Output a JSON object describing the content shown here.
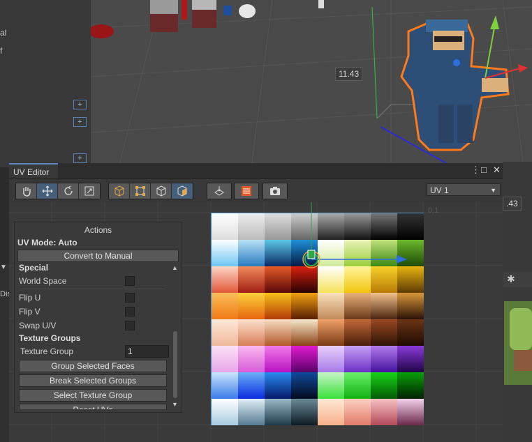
{
  "scene": {
    "distance_label": "11.43",
    "distance_label_2": ".43",
    "left_panel_fragments": [
      "al",
      "f"
    ],
    "bottom_left_fragment": "Dis"
  },
  "uv_editor": {
    "tab_title": "UV Editor",
    "window_controls": {
      "menu": "⋮",
      "maximize": "□",
      "close": "✕"
    },
    "uv_channel": "UV 1",
    "corner_label": "0,1"
  },
  "actions": {
    "title": "Actions",
    "uv_mode": "UV Mode: Auto",
    "convert_button": "Convert to Manual",
    "special_heading": "Special",
    "world_space": "World Space",
    "flip_u": "Flip U",
    "flip_v": "Flip V",
    "swap_uv": "Swap U/V",
    "texture_groups_heading": "Texture Groups",
    "texture_group_label": "Texture Group",
    "texture_group_value": "1",
    "group_selected_faces": "Group Selected Faces",
    "break_selected_groups": "Break Selected Groups",
    "select_texture_group": "Select Texture Group",
    "reset_uvs": "Reset UVs"
  },
  "colors": {
    "accent": "#3d8fd6",
    "selection_outline": "#ff7a1a",
    "uv_handle": "#2fa84a"
  }
}
